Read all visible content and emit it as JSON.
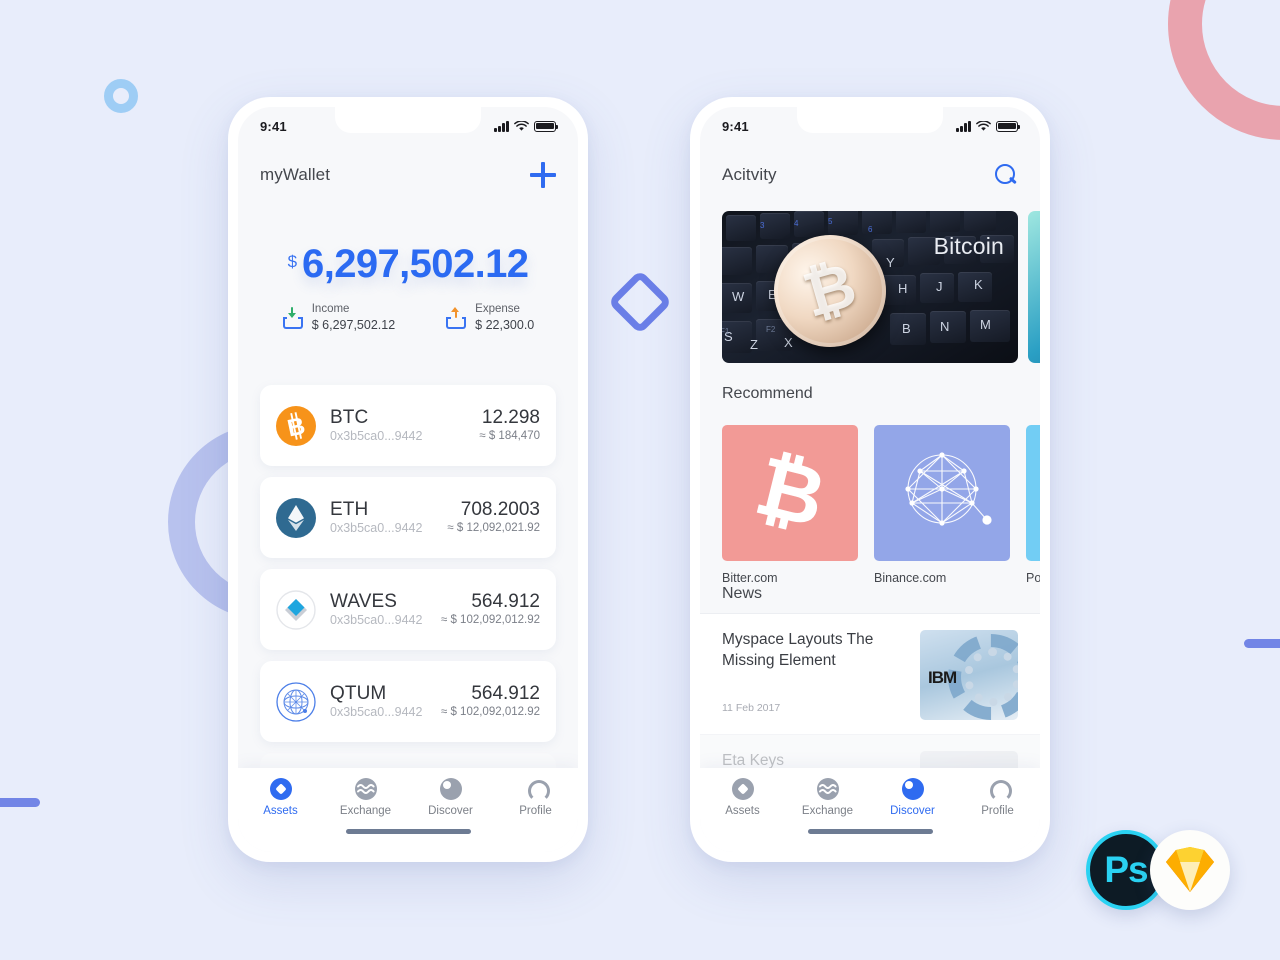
{
  "background": {
    "color": "#e8edfb",
    "shapes": [
      {
        "name": "ring-blue-small",
        "color": "#9ecdf5"
      },
      {
        "name": "ring-pink-corner",
        "color": "#e9a3ae"
      },
      {
        "name": "ring-periwinkle-left",
        "color": "#b8c2ee"
      },
      {
        "name": "diamond-center",
        "color": "#6b7fe8"
      },
      {
        "name": "bar-left",
        "color": "#7285e6"
      },
      {
        "name": "bar-right",
        "color": "#7285e6"
      }
    ]
  },
  "accent": "#2f6bf0",
  "status_bar": {
    "time": "9:41"
  },
  "wallet_screen": {
    "title": "myWallet",
    "add_button": "+",
    "balance": {
      "currency": "$",
      "amount": "6,297,502.12"
    },
    "summary": [
      {
        "label": "Income",
        "value": "$ 6,297,502.12",
        "icon": "tray-down-icon",
        "arrow_color": "#2fae6a"
      },
      {
        "label": "Expense",
        "value": "$ 22,300.0",
        "icon": "tray-up-icon",
        "arrow_color": "#f2932c"
      }
    ],
    "assets": [
      {
        "symbol": "BTC",
        "address": "0x3b5ca0...9442",
        "amount": "12.298",
        "usd": "≈ $ 184,470",
        "icon": "bitcoin-icon",
        "color": "#f7931a"
      },
      {
        "symbol": "ETH",
        "address": "0x3b5ca0...9442",
        "amount": "708.2003",
        "usd": "≈ $ 12,092,021.92",
        "icon": "ethereum-icon",
        "color": "#2f6a91"
      },
      {
        "symbol": "WAVES",
        "address": "0x3b5ca0...9442",
        "amount": "564.912",
        "usd": "≈ $ 102,092,012.92",
        "icon": "waves-icon",
        "color": "#1ea6df"
      },
      {
        "symbol": "QTUM",
        "address": "0x3b5ca0...9442",
        "amount": "564.912",
        "usd": "≈ $ 102,092,012.92",
        "icon": "qtum-icon",
        "color": "#2f6bf0"
      }
    ],
    "tabs": [
      {
        "label": "Assets",
        "icon": "assets-diamond-icon",
        "active": true
      },
      {
        "label": "Exchange",
        "icon": "exchange-wave-icon",
        "active": false
      },
      {
        "label": "Discover",
        "icon": "discover-circle-icon",
        "active": false
      },
      {
        "label": "Profile",
        "icon": "profile-person-icon",
        "active": false
      }
    ]
  },
  "activity_screen": {
    "title": "Acitvity",
    "search_icon": "search-icon",
    "banner": {
      "caption": "Bitcoin",
      "image": "bitcoin-coin-on-keyboard"
    },
    "recommend_title": "Recommend",
    "recommend": [
      {
        "label": "Bitter.com",
        "color": "#f29a96",
        "icon": "bitcoin-b-icon"
      },
      {
        "label": "Binance.com",
        "color": "#93a6e8",
        "icon": "network-polyhedron-icon"
      },
      {
        "label": "Polon",
        "color": "#72cdf4",
        "icon": "partial-icon"
      }
    ],
    "news_title": "News",
    "news": [
      {
        "title": "Myspace Layouts The Missing Element",
        "date": "11 Feb 2017",
        "thumb": "ibm-server-photo"
      },
      {
        "title": "Eta Keys",
        "date": "",
        "thumb": "portrait-photo"
      }
    ],
    "tabs": [
      {
        "label": "Assets",
        "icon": "assets-diamond-icon",
        "active": false
      },
      {
        "label": "Exchange",
        "icon": "exchange-wave-icon",
        "active": false
      },
      {
        "label": "Discover",
        "icon": "discover-circle-icon",
        "active": true
      },
      {
        "label": "Profile",
        "icon": "profile-person-icon",
        "active": false
      }
    ]
  },
  "badges": [
    {
      "name": "photoshop-badge",
      "label": "Ps",
      "color": "#2ad2f2"
    },
    {
      "name": "sketch-badge",
      "label": "",
      "color": "#f7a325"
    }
  ]
}
